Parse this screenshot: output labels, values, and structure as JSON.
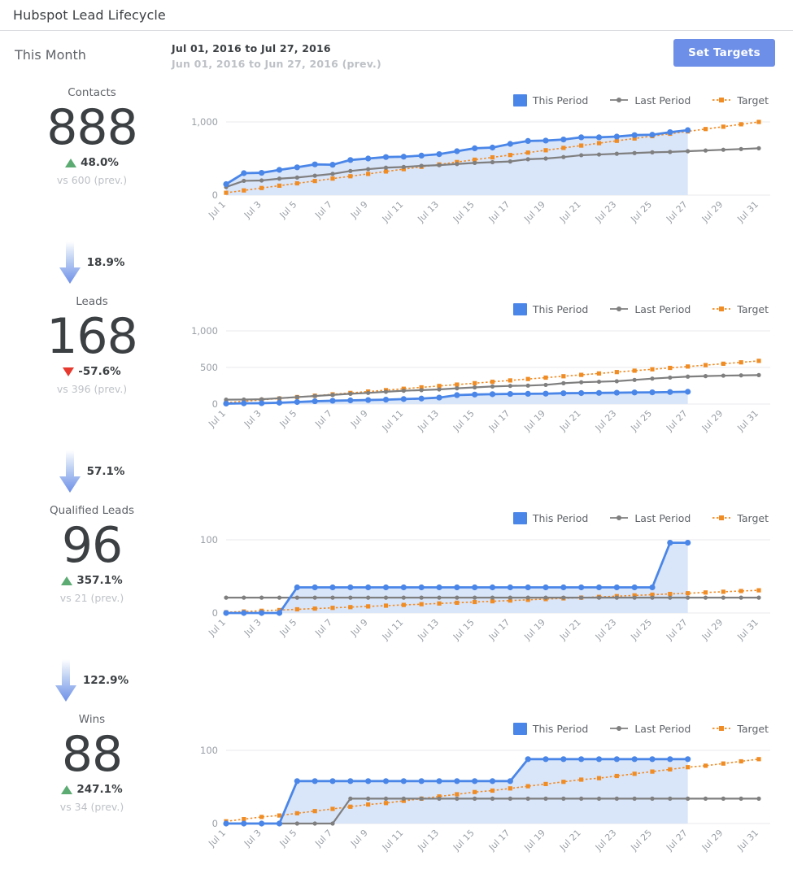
{
  "window": {
    "title": "Hubspot Lead Lifecycle"
  },
  "controls": {
    "period_label": "This Month",
    "date_current": "Jul 01, 2016  to Jul 27, 2016",
    "date_previous": "Jun 01, 2016  to Jun 27, 2016 (prev.)",
    "set_targets_label": "Set Targets"
  },
  "colors": {
    "this_period": "#4a86e8",
    "this_period_fill": "#d9e5f9",
    "last_period": "#7f7f7f",
    "target": "#f08c24",
    "button": "#6d8fe8",
    "up": "#5cab72",
    "down": "#e8392f",
    "grid": "#e8eaed"
  },
  "legend": {
    "this_period": "This Period",
    "last_period": "Last Period",
    "target": "Target"
  },
  "kpis": [
    {
      "label": "Contacts",
      "value": "888",
      "delta": "48.0%",
      "direction": "up",
      "prev": "vs 600 (prev.)"
    },
    {
      "label": "Leads",
      "value": "168",
      "delta": "-57.6%",
      "direction": "down",
      "prev": "vs 396 (prev.)"
    },
    {
      "label": "Qualified Leads",
      "value": "96",
      "delta": "357.1%",
      "direction": "up",
      "prev": "vs 21 (prev.)"
    },
    {
      "label": "Wins",
      "value": "88",
      "delta": "247.1%",
      "direction": "up",
      "prev": "vs 34 (prev.)"
    }
  ],
  "funnels": [
    {
      "pct": "18.9%"
    },
    {
      "pct": "57.1%"
    },
    {
      "pct": "122.9%"
    }
  ],
  "chart_data": [
    {
      "type": "line",
      "title": "Contacts",
      "xlabel": "",
      "ylabel": "",
      "grid": true,
      "legend_position": "top-right",
      "ylim": [
        0,
        1000
      ],
      "yticks": [
        0,
        1000
      ],
      "ytick_labels": [
        "0",
        "1,000"
      ],
      "x": [
        "Jul 1",
        "Jul 2",
        "Jul 3",
        "Jul 4",
        "Jul 5",
        "Jul 6",
        "Jul 7",
        "Jul 8",
        "Jul 9",
        "Jul 10",
        "Jul 11",
        "Jul 12",
        "Jul 13",
        "Jul 14",
        "Jul 15",
        "Jul 16",
        "Jul 17",
        "Jul 18",
        "Jul 19",
        "Jul 20",
        "Jul 21",
        "Jul 22",
        "Jul 23",
        "Jul 24",
        "Jul 25",
        "Jul 26",
        "Jul 27",
        "Jul 28",
        "Jul 29",
        "Jul 30",
        "Jul 31"
      ],
      "xtick_labels": [
        "Jul 1",
        "Jul 3",
        "Jul 5",
        "Jul 7",
        "Jul 9",
        "Jul 11",
        "Jul 13",
        "Jul 15",
        "Jul 17",
        "Jul 19",
        "Jul 21",
        "Jul 23",
        "Jul 25",
        "Jul 27",
        "Jul 29",
        "Jul 31"
      ],
      "series": [
        {
          "name": "This Period",
          "values": [
            150,
            300,
            305,
            345,
            380,
            420,
            415,
            480,
            500,
            520,
            525,
            540,
            560,
            600,
            640,
            650,
            700,
            740,
            745,
            760,
            790,
            790,
            800,
            820,
            825,
            860,
            888,
            null,
            null,
            null,
            null
          ]
        },
        {
          "name": "Last Period",
          "values": [
            110,
            195,
            200,
            225,
            240,
            265,
            290,
            330,
            355,
            375,
            385,
            400,
            410,
            425,
            440,
            450,
            460,
            490,
            500,
            520,
            545,
            555,
            565,
            575,
            585,
            590,
            600,
            610,
            620,
            630,
            640
          ]
        },
        {
          "name": "Target",
          "values": [
            32,
            64,
            97,
            129,
            161,
            193,
            226,
            258,
            290,
            323,
            355,
            387,
            419,
            452,
            484,
            516,
            548,
            581,
            613,
            645,
            677,
            710,
            742,
            774,
            806,
            839,
            871,
            903,
            935,
            968,
            1000
          ]
        }
      ]
    },
    {
      "type": "line",
      "title": "Leads",
      "xlabel": "",
      "ylabel": "",
      "grid": true,
      "legend_position": "top-right",
      "ylim": [
        0,
        1000
      ],
      "yticks": [
        0,
        500,
        1000
      ],
      "ytick_labels": [
        "0",
        "500",
        "1,000"
      ],
      "x": [
        "Jul 1",
        "Jul 2",
        "Jul 3",
        "Jul 4",
        "Jul 5",
        "Jul 6",
        "Jul 7",
        "Jul 8",
        "Jul 9",
        "Jul 10",
        "Jul 11",
        "Jul 12",
        "Jul 13",
        "Jul 14",
        "Jul 15",
        "Jul 16",
        "Jul 17",
        "Jul 18",
        "Jul 19",
        "Jul 20",
        "Jul 21",
        "Jul 22",
        "Jul 23",
        "Jul 24",
        "Jul 25",
        "Jul 26",
        "Jul 27",
        "Jul 28",
        "Jul 29",
        "Jul 30",
        "Jul 31"
      ],
      "xtick_labels": [
        "Jul 1",
        "Jul 3",
        "Jul 5",
        "Jul 7",
        "Jul 9",
        "Jul 11",
        "Jul 13",
        "Jul 15",
        "Jul 17",
        "Jul 19",
        "Jul 21",
        "Jul 23",
        "Jul 25",
        "Jul 27",
        "Jul 29",
        "Jul 31"
      ],
      "series": [
        {
          "name": "This Period",
          "values": [
            6,
            10,
            12,
            18,
            28,
            38,
            45,
            50,
            55,
            60,
            68,
            75,
            88,
            122,
            130,
            135,
            138,
            140,
            142,
            148,
            150,
            152,
            155,
            158,
            160,
            164,
            168,
            null,
            null,
            null,
            null
          ]
        },
        {
          "name": "Last Period",
          "values": [
            60,
            62,
            65,
            80,
            95,
            110,
            125,
            140,
            152,
            168,
            182,
            190,
            200,
            215,
            228,
            240,
            248,
            252,
            262,
            285,
            298,
            305,
            312,
            330,
            348,
            362,
            375,
            382,
            388,
            392,
            396
          ]
        },
        {
          "name": "Target",
          "values": [
            19,
            38,
            57,
            76,
            95,
            114,
            133,
            152,
            171,
            190,
            209,
            228,
            247,
            266,
            285,
            304,
            323,
            342,
            361,
            380,
            399,
            418,
            437,
            456,
            475,
            494,
            513,
            532,
            551,
            570,
            590
          ]
        }
      ]
    },
    {
      "type": "line",
      "title": "Qualified Leads",
      "xlabel": "",
      "ylabel": "",
      "grid": true,
      "legend_position": "top-right",
      "ylim": [
        0,
        100
      ],
      "yticks": [
        0,
        100
      ],
      "ytick_labels": [
        "0",
        "100"
      ],
      "x": [
        "Jul 1",
        "Jul 2",
        "Jul 3",
        "Jul 4",
        "Jul 5",
        "Jul 6",
        "Jul 7",
        "Jul 8",
        "Jul 9",
        "Jul 10",
        "Jul 11",
        "Jul 12",
        "Jul 13",
        "Jul 14",
        "Jul 15",
        "Jul 16",
        "Jul 17",
        "Jul 18",
        "Jul 19",
        "Jul 20",
        "Jul 21",
        "Jul 22",
        "Jul 23",
        "Jul 24",
        "Jul 25",
        "Jul 26",
        "Jul 27",
        "Jul 28",
        "Jul 29",
        "Jul 30",
        "Jul 31"
      ],
      "xtick_labels": [
        "Jul 1",
        "Jul 3",
        "Jul 5",
        "Jul 7",
        "Jul 9",
        "Jul 11",
        "Jul 13",
        "Jul 15",
        "Jul 17",
        "Jul 19",
        "Jul 21",
        "Jul 23",
        "Jul 25",
        "Jul 27",
        "Jul 29",
        "Jul 31"
      ],
      "series": [
        {
          "name": "This Period",
          "values": [
            0,
            0,
            0,
            0,
            35,
            35,
            35,
            35,
            35,
            35,
            35,
            35,
            35,
            35,
            35,
            35,
            35,
            35,
            35,
            35,
            35,
            35,
            35,
            35,
            35,
            96,
            96,
            null,
            null,
            null,
            null
          ]
        },
        {
          "name": "Last Period",
          "values": [
            21,
            21,
            21,
            21,
            21,
            21,
            21,
            21,
            21,
            21,
            21,
            21,
            21,
            21,
            21,
            21,
            21,
            21,
            21,
            21,
            21,
            21,
            21,
            21,
            21,
            21,
            21,
            21,
            21,
            21,
            21
          ]
        },
        {
          "name": "Target",
          "values": [
            1,
            2,
            3,
            4,
            5,
            6,
            7,
            8,
            9,
            10,
            11,
            12,
            13,
            14,
            15,
            16,
            17,
            18,
            19,
            20,
            21,
            22,
            23,
            24,
            25,
            26,
            27,
            28,
            29,
            30,
            31
          ]
        }
      ]
    },
    {
      "type": "line",
      "title": "Wins",
      "xlabel": "",
      "ylabel": "",
      "grid": true,
      "legend_position": "top-right",
      "ylim": [
        0,
        100
      ],
      "yticks": [
        0,
        100
      ],
      "ytick_labels": [
        "0",
        "100"
      ],
      "x": [
        "Jul 1",
        "Jul 2",
        "Jul 3",
        "Jul 4",
        "Jul 5",
        "Jul 6",
        "Jul 7",
        "Jul 8",
        "Jul 9",
        "Jul 10",
        "Jul 11",
        "Jul 12",
        "Jul 13",
        "Jul 14",
        "Jul 15",
        "Jul 16",
        "Jul 17",
        "Jul 18",
        "Jul 19",
        "Jul 20",
        "Jul 21",
        "Jul 22",
        "Jul 23",
        "Jul 24",
        "Jul 25",
        "Jul 26",
        "Jul 27",
        "Jul 28",
        "Jul 29",
        "Jul 30",
        "Jul 31"
      ],
      "xtick_labels": [
        "Jul 1",
        "Jul 3",
        "Jul 5",
        "Jul 7",
        "Jul 9",
        "Jul 11",
        "Jul 13",
        "Jul 15",
        "Jul 17",
        "Jul 19",
        "Jul 21",
        "Jul 23",
        "Jul 25",
        "Jul 27",
        "Jul 29",
        "Jul 31"
      ],
      "series": [
        {
          "name": "This Period",
          "values": [
            0,
            0,
            0,
            0,
            58,
            58,
            58,
            58,
            58,
            58,
            58,
            58,
            58,
            58,
            58,
            58,
            58,
            88,
            88,
            88,
            88,
            88,
            88,
            88,
            88,
            88,
            88,
            null,
            null,
            null,
            null
          ]
        },
        {
          "name": "Last Period",
          "values": [
            0,
            0,
            0,
            0,
            0,
            0,
            0,
            34,
            34,
            34,
            34,
            34,
            34,
            34,
            34,
            34,
            34,
            34,
            34,
            34,
            34,
            34,
            34,
            34,
            34,
            34,
            34,
            34,
            34,
            34,
            34
          ]
        },
        {
          "name": "Target",
          "values": [
            3,
            6,
            9,
            11,
            14,
            17,
            20,
            23,
            26,
            28,
            31,
            34,
            37,
            40,
            43,
            45,
            48,
            51,
            54,
            57,
            60,
            62,
            65,
            68,
            71,
            74,
            77,
            79,
            82,
            85,
            88
          ]
        }
      ]
    }
  ]
}
